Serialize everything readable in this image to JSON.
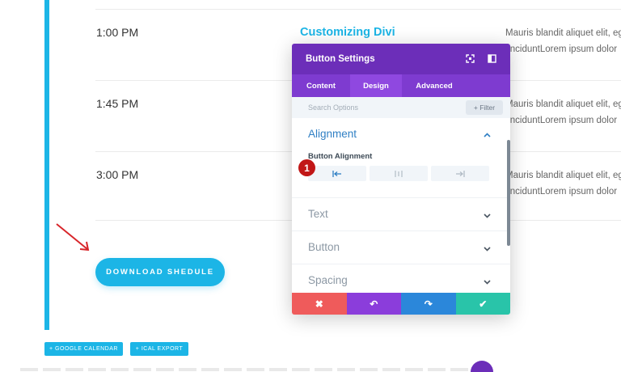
{
  "schedule": {
    "rows": [
      {
        "time": "1:00 PM",
        "title": "Customizing Divi",
        "desc_line1": "Mauris blandit aliquet elit, eg",
        "desc_line2": "tinciduntLorem ipsum dolor"
      },
      {
        "time": "1:45 PM",
        "title": "",
        "desc_line1": "Mauris blandit aliquet elit, eg",
        "desc_line2": "tinciduntLorem ipsum dolor"
      },
      {
        "time": "3:00 PM",
        "title": "",
        "desc_line1": "Mauris blandit aliquet elit, eg",
        "desc_line2": "tinciduntLorem ipsum dolor"
      }
    ],
    "download_label": "DOWNLOAD SHEDULE",
    "google_calendar_label": "+ GOOGLE CALENDAR",
    "ical_export_label": "+ ICAL EXPORT"
  },
  "modal": {
    "title": "Button Settings",
    "tabs": [
      "Content",
      "Design",
      "Advanced"
    ],
    "active_tab": "Design",
    "search_placeholder": "Search Options",
    "filter_label": "+ Filter",
    "sections": [
      {
        "label": "Alignment",
        "expanded": true
      },
      {
        "label": "Text",
        "expanded": false
      },
      {
        "label": "Button",
        "expanded": false
      },
      {
        "label": "Spacing",
        "expanded": false
      }
    ],
    "alignment_label": "Button Alignment",
    "alignment_options": [
      "left",
      "center",
      "right"
    ],
    "alignment_selected": "left",
    "step_badge": "1",
    "footer": {
      "cancel_icon": "✖",
      "undo_icon": "↶",
      "redo_icon": "↷",
      "save_icon": "✔"
    }
  },
  "colors": {
    "accent_blue": "#1cb5e6",
    "modal_purple": "#6c2eb9",
    "cancel_red": "#ef5b5b",
    "undo_purple": "#8b3ddb",
    "redo_blue": "#2b87da",
    "save_green": "#29c4a9",
    "annotation_red": "#c11717"
  }
}
